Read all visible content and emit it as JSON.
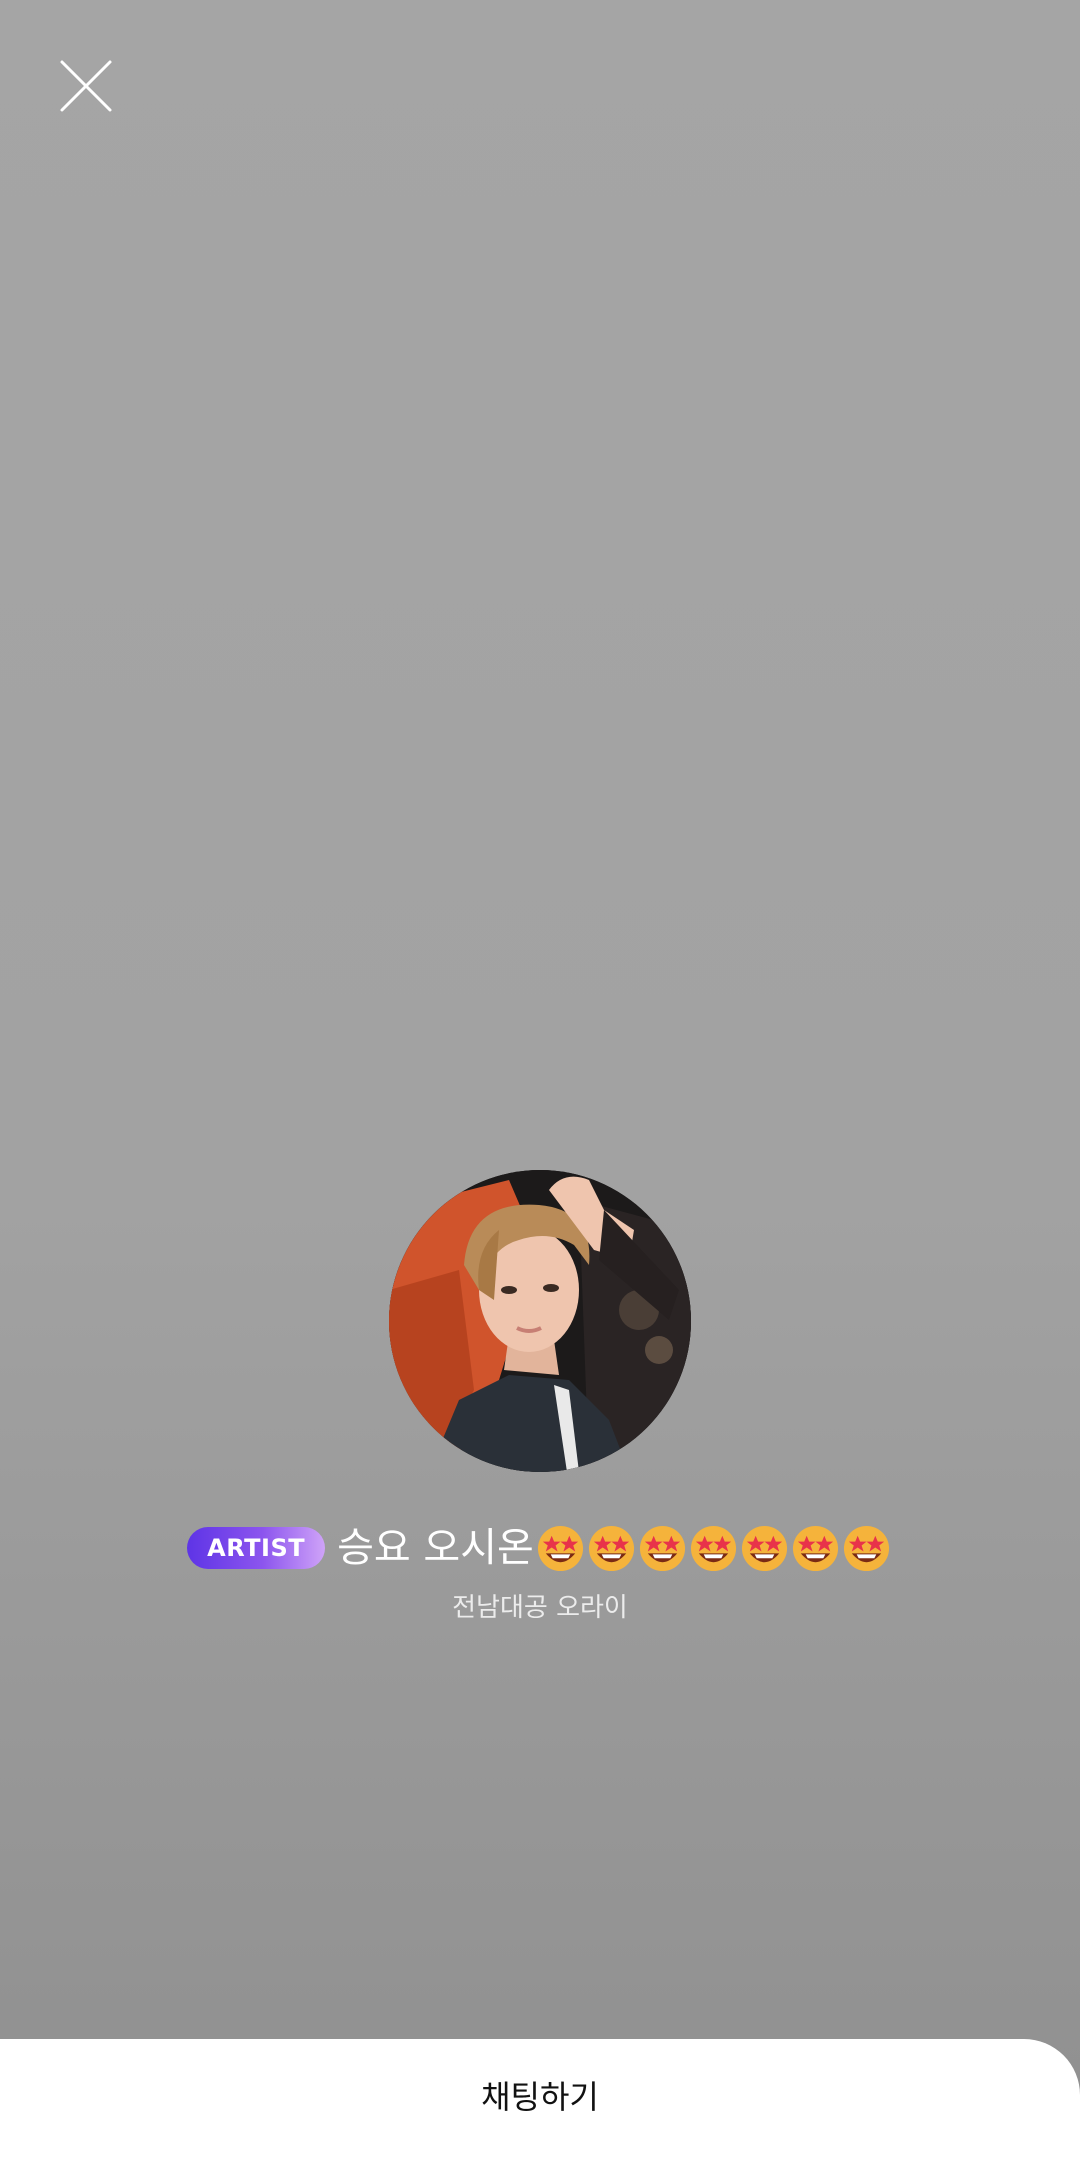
{
  "header": {
    "close_icon": "close-icon"
  },
  "profile": {
    "avatar_alt": "avatar",
    "badge": "ARTIST",
    "name": "승요 오시온",
    "emoji_icon": "star-struck-emoji",
    "emoji_count": 7,
    "affiliation": "전남대공 오라이"
  },
  "footer": {
    "chat_button_label": "채팅하기"
  },
  "colors": {
    "background_top": "#a5a5a5",
    "background_bottom": "#8f8f8f",
    "badge_start": "#5e34e6",
    "badge_end": "#cfa3f8",
    "footer_bg": "#ffffff"
  }
}
